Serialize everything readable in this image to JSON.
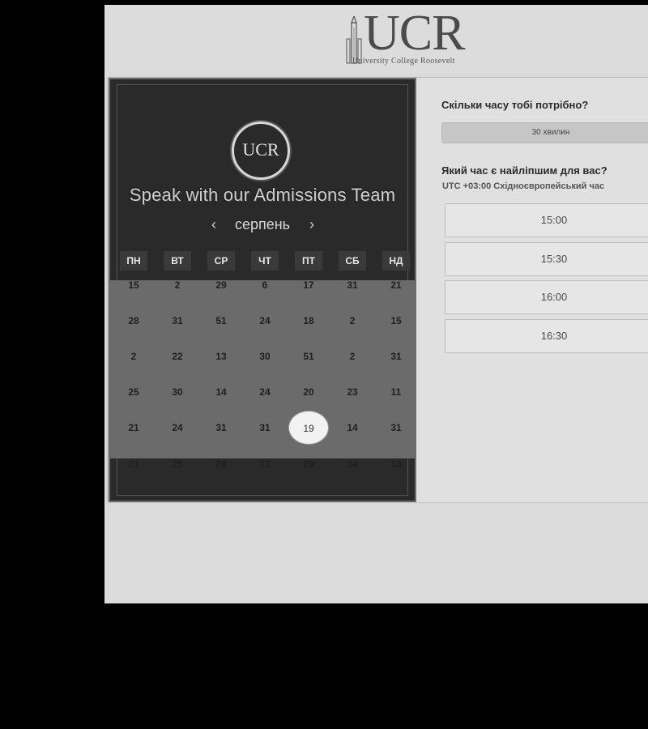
{
  "brand": {
    "logo_letters": "UCR",
    "logo_subtitle": "University College Roosevelt"
  },
  "calendar": {
    "emblem_text": "UCR",
    "title": "Speak with our Admissions Team",
    "month": "серпень",
    "prev_arrow": "‹",
    "next_arrow": "›",
    "weekdays": [
      "ПН",
      "ВТ",
      "СР",
      "ЧТ",
      "ПТ",
      "СБ",
      "НД"
    ],
    "rows": [
      [
        "15",
        "2",
        "29",
        "6",
        "17",
        "31",
        "21"
      ],
      [
        "28",
        "31",
        "51",
        "24",
        "18",
        "2",
        "15"
      ],
      [
        "2",
        "22",
        "13",
        "30",
        "51",
        "2",
        "31"
      ],
      [
        "25",
        "30",
        "14",
        "24",
        "20",
        "23",
        "11"
      ],
      [
        "21",
        "24",
        "31",
        "31",
        "19",
        "14",
        "31"
      ],
      [
        "21",
        "25",
        "28",
        "27",
        "29",
        "24",
        "13"
      ]
    ],
    "selected_day": "19"
  },
  "booking": {
    "duration_question": "Скільки часу тобі потрібно?",
    "duration_value": "30 хвилин",
    "time_question": "Який час є найліпшим для вас?",
    "timezone": "UTC +03:00 Східноєвропейський час",
    "slots": [
      "15:00",
      "15:30",
      "16:00",
      "16:30"
    ]
  }
}
